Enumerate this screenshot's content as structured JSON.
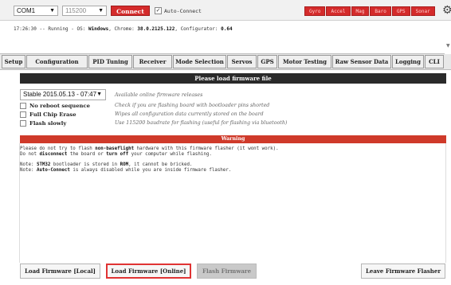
{
  "toolbar": {
    "port": "COM1",
    "baud": "115200",
    "connect_label": "Connect",
    "auto_connect_label": "Auto-Connect",
    "auto_connect_checked": "✓",
    "sensors": [
      "Gyro",
      "Accel",
      "Mag",
      "Baro",
      "GPS",
      "Sonar"
    ],
    "sensor_color": "#d42b2b"
  },
  "log": {
    "time": "17:26:30",
    "prefix": "-- Running - OS: ",
    "os": "Windows",
    "chrome_prefix": ", Chrome: ",
    "chrome": "38.0.2125.122",
    "config_prefix": ", Configurator: ",
    "configurator": "0.64"
  },
  "tabs": [
    "Setup",
    "Configuration",
    "PID Tuning",
    "Receiver",
    "Mode Selection",
    "Servos",
    "GPS",
    "Motor Testing",
    "Raw Sensor Data",
    "Logging",
    "CLI"
  ],
  "flasher": {
    "header": "Please load firmware file",
    "firmware_version": "Stable 2015.05.13 - 07:47",
    "firmware_desc": "Available online firmware releases",
    "options": [
      {
        "label": "No reboot sequence",
        "desc": "Check if you are flashing board with bootloader pins shorted"
      },
      {
        "label": "Full Chip Erase",
        "desc": "Wipes all configuration data currently stored on the board"
      },
      {
        "label": "Flash slowly",
        "desc": "Use 115200 baudrate for flashing (useful for flashing via bluetooth)"
      }
    ],
    "warning_title": "Warning",
    "warning": {
      "l1_a": "Please do not try to flash ",
      "l1_b": "non-baseflight",
      "l1_c": " hardware with this firmware flasher (it wont work).",
      "l2_a": "Do not ",
      "l2_b": "disconnect",
      "l2_c": " the board or ",
      "l2_d": "turn off",
      "l2_e": " your computer while flashing.",
      "l3_a": "Note: ",
      "l3_b": "STM32",
      "l3_c": " bootloader is stored in ",
      "l3_d": "ROM",
      "l3_e": ", it cannot be bricked.",
      "l4_a": "Note: ",
      "l4_b": "Auto-Connect",
      "l4_c": " is always disabled while you are inside firmware flasher."
    },
    "buttons": {
      "load_local": "Load Firmware [Local]",
      "load_online": "Load Firmware [Online]",
      "flash": "Flash Firmware",
      "leave": "Leave Firmware Flasher"
    }
  }
}
